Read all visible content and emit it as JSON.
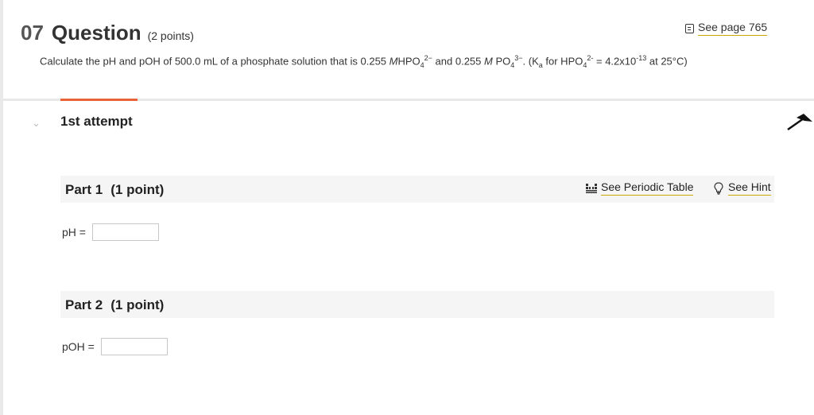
{
  "question": {
    "number": "07",
    "word": "Question",
    "points": "(2 points)",
    "see_page": "See page 765",
    "text": {
      "t1": "Calculate the pH and pOH of 500.0 mL of a phosphate solution that is 0.255 ",
      "m1": "M",
      "t2": "HPO",
      "s1": "4",
      "p1": "2−",
      "t3": " and 0.255 ",
      "m2": "M",
      "t4": " PO",
      "s2": "4",
      "p2": "3−",
      "t5": ". (K",
      "s3": "a",
      "t6": " for HPO",
      "s4": "4",
      "p3": "2-",
      "t7": " = 4.2x10",
      "p4": "-13",
      "t8": " at 25°C)"
    }
  },
  "attempt": {
    "label": "1st attempt"
  },
  "parts": [
    {
      "title": "Part 1",
      "points": "(1 point)",
      "periodic_table": "See Periodic Table",
      "hint": "See Hint",
      "field_label": "pH =",
      "field_value": ""
    },
    {
      "title": "Part 2",
      "points": "(1 point)",
      "field_label": "pOH =",
      "field_value": ""
    }
  ],
  "colors": {
    "accent": "#e8623a",
    "link_underline": "#c9a700",
    "part_bg": "#f5f5f5"
  },
  "icons": [
    "book-icon",
    "chevron-down-icon",
    "periodic-table-icon",
    "lightbulb-icon",
    "cursor-icon"
  ]
}
